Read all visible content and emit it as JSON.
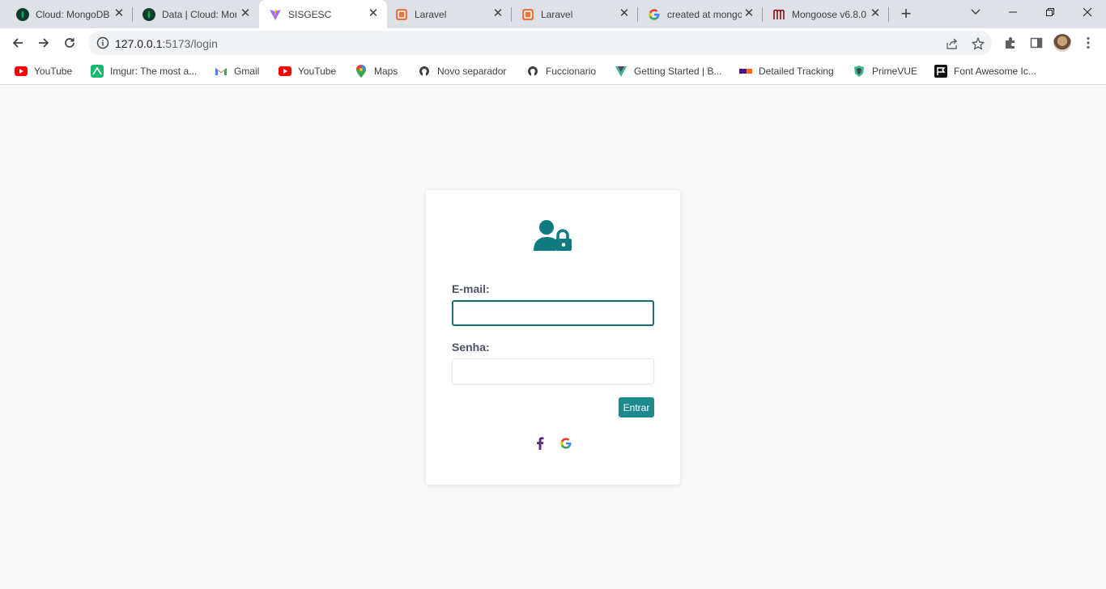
{
  "browser": {
    "tabs": [
      {
        "title": "Cloud: MongoDB Cloud",
        "icon": "mongodb-leaf-icon",
        "active": false
      },
      {
        "title": "Data | Cloud: MongoDB Cloud",
        "icon": "mongodb-leaf-icon",
        "active": false
      },
      {
        "title": "SISGESC",
        "icon": "vite-icon",
        "active": true
      },
      {
        "title": "Laravel",
        "icon": "laravel-icon",
        "active": false
      },
      {
        "title": "Laravel",
        "icon": "laravel-icon",
        "active": false
      },
      {
        "title": "created at mongoose",
        "icon": "google-icon",
        "active": false
      },
      {
        "title": "Mongoose v6.8.0",
        "icon": "mongoose-icon",
        "active": false
      }
    ],
    "close_glyph": "✕",
    "new_tab_glyph": "+",
    "url_host": "127.0.0.1",
    "url_rest": ":5173/login",
    "bookmarks": [
      {
        "label": "YouTube",
        "icon": "youtube-icon"
      },
      {
        "label": "Imgur: The most a...",
        "icon": "imgur-icon"
      },
      {
        "label": "Gmail",
        "icon": "gmail-icon"
      },
      {
        "label": "YouTube",
        "icon": "youtube-icon"
      },
      {
        "label": "Maps",
        "icon": "maps-icon"
      },
      {
        "label": "Novo separador",
        "icon": "github-icon"
      },
      {
        "label": "Fuccionario",
        "icon": "github-icon"
      },
      {
        "label": "Getting Started | B...",
        "icon": "bootstrap-vue-icon"
      },
      {
        "label": "Detailed Tracking",
        "icon": "fedex-icon"
      },
      {
        "label": "PrimeVUE",
        "icon": "primevue-icon"
      },
      {
        "label": "Font Awesome Ic...",
        "icon": "font-awesome-icon"
      }
    ]
  },
  "login": {
    "icon": "user-lock-icon",
    "email_label": "E-mail:",
    "email_value": "",
    "senha_label": "Senha:",
    "senha_value": "",
    "submit_label": "Entrar",
    "social": [
      "facebook-icon",
      "google-icon"
    ]
  },
  "colors": {
    "accent": "#0f6d73",
    "button": "#1e8a8f",
    "facebook": "#5b2a86",
    "background": "#f8f8f8"
  }
}
